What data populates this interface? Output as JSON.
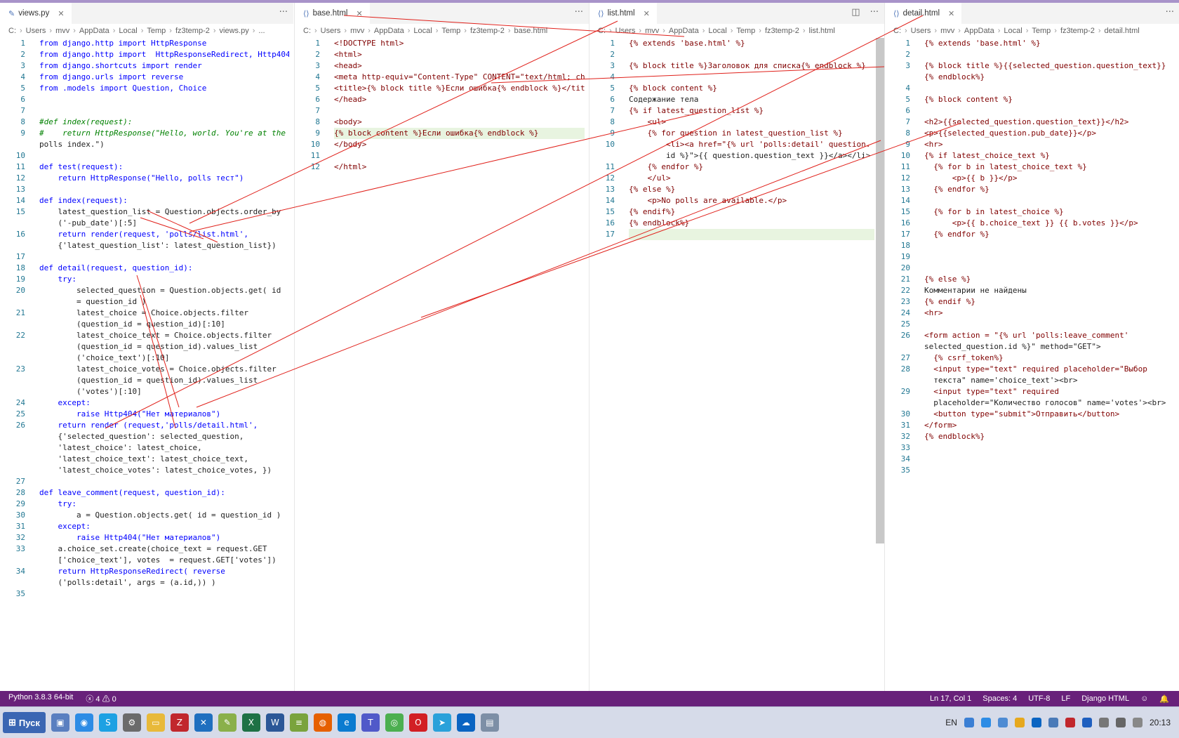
{
  "editor_panes": [
    {
      "tab": "views.py",
      "breadcrumb": [
        "C:",
        "Users",
        "mvv",
        "AppData",
        "Local",
        "Temp",
        "fz3temp-2",
        "views.py",
        "..."
      ],
      "lines": [
        {
          "n": "1",
          "t": "from django.http import HttpResponse"
        },
        {
          "n": "2",
          "t": "from django.http import  HttpResponseRedirect, Http404"
        },
        {
          "n": "3",
          "t": "from django.shortcuts import render"
        },
        {
          "n": "4",
          "t": "from django.urls import reverse"
        },
        {
          "n": "5",
          "t": "from .models import Question, Choice"
        },
        {
          "n": "6",
          "t": ""
        },
        {
          "n": "7",
          "t": ""
        },
        {
          "n": "8",
          "t": "#def index(request):"
        },
        {
          "n": "9",
          "t": "#    return HttpResponse(\"Hello, world. You're at the"
        },
        {
          "n": "",
          "t": "polls index.\")"
        },
        {
          "n": "10",
          "t": ""
        },
        {
          "n": "11",
          "t": "def test(request):"
        },
        {
          "n": "12",
          "t": "    return HttpResponse(\"Hello, polls тест\")"
        },
        {
          "n": "13",
          "t": ""
        },
        {
          "n": "14",
          "t": "def index(request):"
        },
        {
          "n": "15",
          "t": "    latest_question_list = Question.objects.order_by"
        },
        {
          "n": "",
          "t": "    ('-pub_date')[:5]"
        },
        {
          "n": "16",
          "t": "    return render(request, 'polls/list.html',"
        },
        {
          "n": "",
          "t": "    {'latest_question_list': latest_question_list})"
        },
        {
          "n": "17",
          "t": ""
        },
        {
          "n": "18",
          "t": "def detail(request, question_id):"
        },
        {
          "n": "19",
          "t": "    try:"
        },
        {
          "n": "20",
          "t": "        selected_question = Question.objects.get( id"
        },
        {
          "n": "",
          "t": "        = question_id )"
        },
        {
          "n": "21",
          "t": "        latest_choice = Choice.objects.filter"
        },
        {
          "n": "",
          "t": "        (question_id = question_id)[:10]"
        },
        {
          "n": "22",
          "t": "        latest_choice_text = Choice.objects.filter"
        },
        {
          "n": "",
          "t": "        (question_id = question_id).values_list"
        },
        {
          "n": "",
          "t": "        ('choice_text')[:10]"
        },
        {
          "n": "23",
          "t": "        latest_choice_votes = Choice.objects.filter"
        },
        {
          "n": "",
          "t": "        (question_id = question_id).values_list"
        },
        {
          "n": "",
          "t": "        ('votes')[:10]"
        },
        {
          "n": "24",
          "t": "    except:"
        },
        {
          "n": "25",
          "t": "        raise Http404(\"Нет материалов\")"
        },
        {
          "n": "26",
          "t": "    return render (request,'polls/detail.html',"
        },
        {
          "n": "",
          "t": "    {'selected_question': selected_question,"
        },
        {
          "n": "",
          "t": "    'latest_choice': latest_choice,"
        },
        {
          "n": "",
          "t": "    'latest_choice_text': latest_choice_text,"
        },
        {
          "n": "",
          "t": "    'latest_choice_votes': latest_choice_votes, })"
        },
        {
          "n": "27",
          "t": ""
        },
        {
          "n": "28",
          "t": "def leave_comment(request, question_id):"
        },
        {
          "n": "29",
          "t": "    try:"
        },
        {
          "n": "30",
          "t": "        a = Question.objects.get( id = question_id )"
        },
        {
          "n": "31",
          "t": "    except:"
        },
        {
          "n": "32",
          "t": "        raise Http404(\"Нет материалов\")"
        },
        {
          "n": "33",
          "t": "    a.choice_set.create(choice_text = request.GET"
        },
        {
          "n": "",
          "t": "    ['choice_text'], votes  = request.GET['votes'])"
        },
        {
          "n": "34",
          "t": "    return HttpResponseRedirect( reverse"
        },
        {
          "n": "",
          "t": "    ('polls:detail', args = (a.id,)) )"
        },
        {
          "n": "35",
          "t": ""
        }
      ]
    },
    {
      "tab": "base.html",
      "breadcrumb": [
        "C:",
        "Users",
        "mvv",
        "AppData",
        "Local",
        "Temp",
        "fz3temp-2",
        "base.html"
      ],
      "lines": [
        {
          "n": "1",
          "t": "<!DOCTYPE html>"
        },
        {
          "n": "2",
          "t": "<html>"
        },
        {
          "n": "3",
          "t": "<head>"
        },
        {
          "n": "4",
          "t": "<meta http-equiv=\"Content-Type\" CONTENT=\"text/html; chars"
        },
        {
          "n": "5",
          "t": "<title>{% block title %}Если ошибка{% endblock %}</title>"
        },
        {
          "n": "6",
          "t": "</head>"
        },
        {
          "n": "7",
          "t": ""
        },
        {
          "n": "8",
          "t": "<body>"
        },
        {
          "n": "9",
          "t": "{% block content %}Если ошибка{% endblock %}"
        },
        {
          "n": "10",
          "t": "</body>"
        },
        {
          "n": "11",
          "t": ""
        },
        {
          "n": "12",
          "t": "</html>"
        }
      ]
    },
    {
      "tab": "list.html",
      "breadcrumb": [
        "C:",
        "Users",
        "mvv",
        "AppData",
        "Local",
        "Temp",
        "fz3temp-2",
        "list.html"
      ],
      "lines": [
        {
          "n": "1",
          "t": "{% extends 'base.html' %}"
        },
        {
          "n": "2",
          "t": ""
        },
        {
          "n": "3",
          "t": "{% block title %}Заголовок для списка{% endblock %}"
        },
        {
          "n": "4",
          "t": ""
        },
        {
          "n": "5",
          "t": "{% block content %}"
        },
        {
          "n": "6",
          "t": "Содержание тела"
        },
        {
          "n": "7",
          "t": "{% if latest_question_list %}"
        },
        {
          "n": "8",
          "t": "    <ul>"
        },
        {
          "n": "9",
          "t": "    {% for question in latest_question_list %}"
        },
        {
          "n": "10",
          "t": "        <li><a href=\"{% url 'polls:detail' question."
        },
        {
          "n": "",
          "t": "        id %}\">{{ question.question_text }}</a></li>"
        },
        {
          "n": "11",
          "t": "    {% endfor %}"
        },
        {
          "n": "12",
          "t": "    </ul>"
        },
        {
          "n": "13",
          "t": "{% else %}"
        },
        {
          "n": "14",
          "t": "    <p>No polls are available.</p>"
        },
        {
          "n": "15",
          "t": "{% endif%}"
        },
        {
          "n": "16",
          "t": "{% endblock%}"
        },
        {
          "n": "17",
          "t": ""
        }
      ]
    },
    {
      "tab": "detail.html",
      "breadcrumb": [
        "C:",
        "Users",
        "mvv",
        "AppData",
        "Local",
        "Temp",
        "fz3temp-2",
        "detail.html"
      ],
      "lines": [
        {
          "n": "1",
          "t": "{% extends 'base.html' %}"
        },
        {
          "n": "2",
          "t": ""
        },
        {
          "n": "3",
          "t": "{% block title %}{{selected_question.question_text}}"
        },
        {
          "n": "",
          "t": "{% endblock%}"
        },
        {
          "n": "4",
          "t": ""
        },
        {
          "n": "5",
          "t": "{% block content %}"
        },
        {
          "n": "6",
          "t": ""
        },
        {
          "n": "7",
          "t": "<h2>{{selected_question.question_text}}</h2>"
        },
        {
          "n": "8",
          "t": "<p>{{selected_question.pub_date}}</p>"
        },
        {
          "n": "9",
          "t": "<hr>"
        },
        {
          "n": "10",
          "t": "{% if latest_choice_text %}"
        },
        {
          "n": "11",
          "t": "  {% for b in latest_choice_text %}"
        },
        {
          "n": "12",
          "t": "      <p>{{ b }}</p>"
        },
        {
          "n": "13",
          "t": "  {% endfor %}"
        },
        {
          "n": "14",
          "t": ""
        },
        {
          "n": "15",
          "t": "  {% for b in latest_choice %}"
        },
        {
          "n": "16",
          "t": "      <p>{{ b.choice_text }} {{ b.votes }}</p>"
        },
        {
          "n": "17",
          "t": "  {% endfor %}"
        },
        {
          "n": "18",
          "t": ""
        },
        {
          "n": "19",
          "t": ""
        },
        {
          "n": "20",
          "t": ""
        },
        {
          "n": "21",
          "t": "{% else %}"
        },
        {
          "n": "22",
          "t": "Комментарии не найдены"
        },
        {
          "n": "23",
          "t": "{% endif %}"
        },
        {
          "n": "24",
          "t": "<hr>"
        },
        {
          "n": "25",
          "t": ""
        },
        {
          "n": "26",
          "t": "<form action = \"{% url 'polls:leave_comment'"
        },
        {
          "n": "",
          "t": "selected_question.id %}\" method=\"GET\">"
        },
        {
          "n": "27",
          "t": "  {% csrf_token%}"
        },
        {
          "n": "28",
          "t": "  <input type=\"text\" required placeholder=\"Выбор"
        },
        {
          "n": "",
          "t": "  текста\" name='choice_text'><br>"
        },
        {
          "n": "29",
          "t": "  <input type=\"text\" required"
        },
        {
          "n": "",
          "t": "  placeholder=\"Количество голосов\" name='votes'><br>"
        },
        {
          "n": "30",
          "t": "  <button type=\"submit\">Отправить</button>"
        },
        {
          "n": "31",
          "t": "</form>"
        },
        {
          "n": "32",
          "t": "{% endblock%}"
        },
        {
          "n": "33",
          "t": ""
        },
        {
          "n": "34",
          "t": ""
        },
        {
          "n": "35",
          "t": ""
        }
      ]
    }
  ],
  "status_bar": {
    "python": "Python 3.8.3 64-bit",
    "errors": "4",
    "warnings": "0",
    "position": "Ln 17, Col 1",
    "spaces": "Spaces: 4",
    "encoding": "UTF-8",
    "eol": "LF",
    "language": "Django HTML"
  },
  "taskbar": {
    "start_label": "Пуск",
    "lang": "EN",
    "clock": "20:13"
  },
  "colors": {
    "status_bar": "#68217a",
    "keyword": "#0000ff",
    "string": "#a31515",
    "comment": "#008000",
    "annotation_lines": "#e0201a"
  }
}
